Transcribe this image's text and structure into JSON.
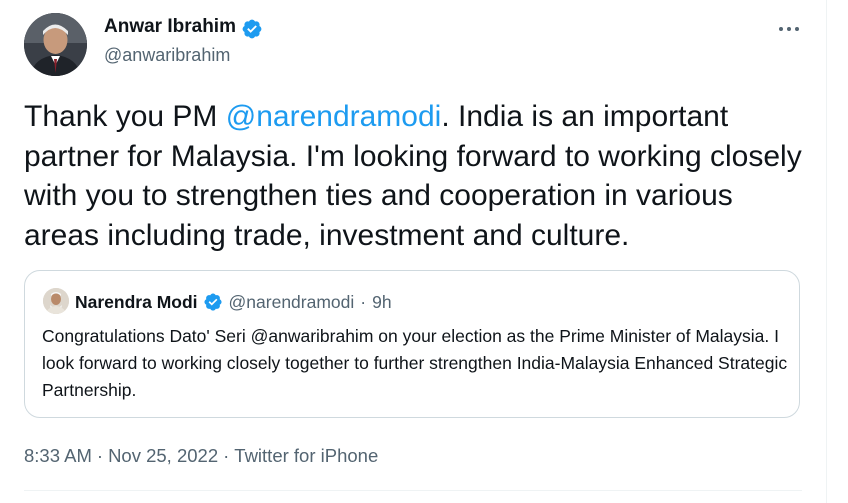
{
  "author": {
    "name": "Anwar Ibrahim",
    "handle": "@anwaribrahim",
    "verified": true
  },
  "tweet": {
    "text_before": "Thank you PM ",
    "mention": "@narendramodi",
    "text_after": ". India is an important partner for Malaysia. I'm looking forward to working closely with you to strengthen ties and cooperation in various areas including trade, investment and culture."
  },
  "quoted": {
    "name": "Narendra Modi",
    "handle": "@narendramodi",
    "separator": "·",
    "time": "9h",
    "verified": true,
    "text": "Congratulations Dato' Seri @anwaribrahim on your election as the Prime Minister of Malaysia. I look forward to working closely together to further strengthen India-Malaysia Enhanced Strategic Partnership."
  },
  "meta": {
    "time": "8:33 AM",
    "date": "Nov 25, 2022",
    "source": "Twitter for iPhone",
    "separator": "·"
  },
  "icons": {
    "verified": "verified-badge-icon",
    "more": "more-options-icon"
  },
  "colors": {
    "link": "#1d9bf0",
    "secondary_text": "#536471",
    "border": "#cfd9de",
    "verified": "#1d9bf0"
  }
}
